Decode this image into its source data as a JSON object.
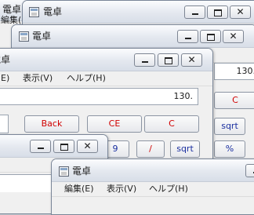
{
  "app": {
    "title": "電卓",
    "edit_cut": "編集(",
    "menu": {
      "edit": "編集(E)",
      "edit_partial": "E)",
      "view": "表示(V)",
      "help": "ヘルプ(H)"
    },
    "display_value": "130.",
    "buttons": {
      "back": "Back",
      "ce": "CE",
      "c": "C",
      "sqrt": "sqrt",
      "percent": "%",
      "divide": "/",
      "nine": "9"
    },
    "caption_close": "✕"
  }
}
